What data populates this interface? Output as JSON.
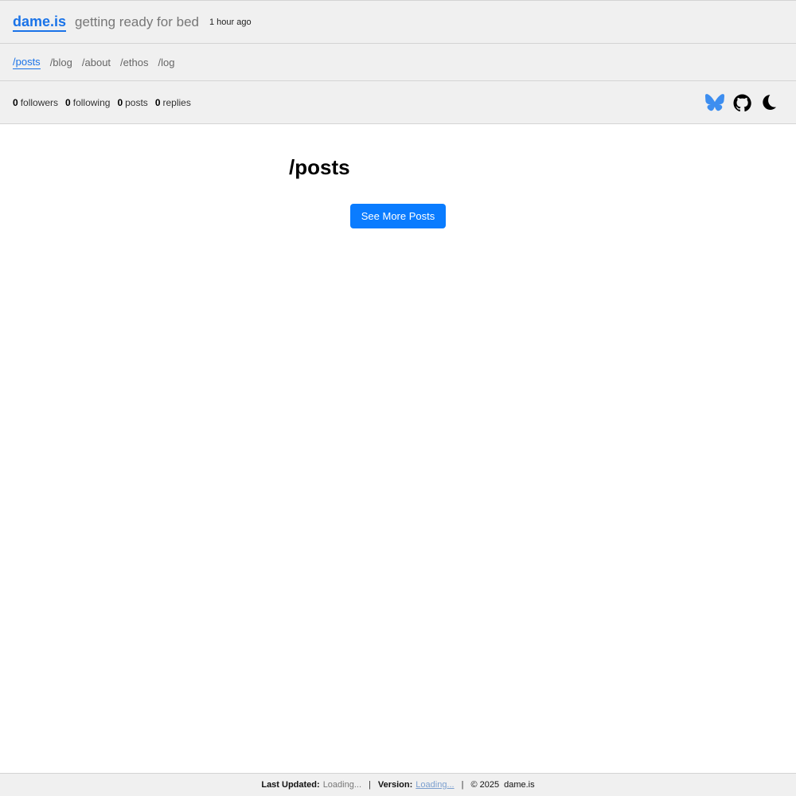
{
  "header": {
    "site_title": "dame.is",
    "status": "getting ready for bed",
    "status_time": "1 hour ago"
  },
  "nav": {
    "items": [
      {
        "label": "/posts",
        "active": true
      },
      {
        "label": "/blog",
        "active": false
      },
      {
        "label": "/about",
        "active": false
      },
      {
        "label": "/ethos",
        "active": false
      },
      {
        "label": "/log",
        "active": false
      }
    ]
  },
  "stats": {
    "followers_count": "0",
    "followers_label": "followers",
    "following_count": "0",
    "following_label": "following",
    "posts_count": "0",
    "posts_label": "posts",
    "replies_count": "0",
    "replies_label": "replies"
  },
  "icons": [
    "bluesky-butterfly-icon",
    "github-icon",
    "dark-mode-moon-icon"
  ],
  "main": {
    "title": "/posts",
    "more_button": "See More Posts"
  },
  "footer": {
    "last_updated_label": "Last Updated:",
    "last_updated_value": "Loading...",
    "version_label": "Version:",
    "version_value": "Loading...",
    "copyright": "© 2025",
    "site": "dame.is"
  },
  "colors": {
    "accent": "#1a73e8",
    "button": "#0a7cff",
    "bar_bg": "#f0f0f0",
    "bluesky": "#3d8ef0"
  }
}
